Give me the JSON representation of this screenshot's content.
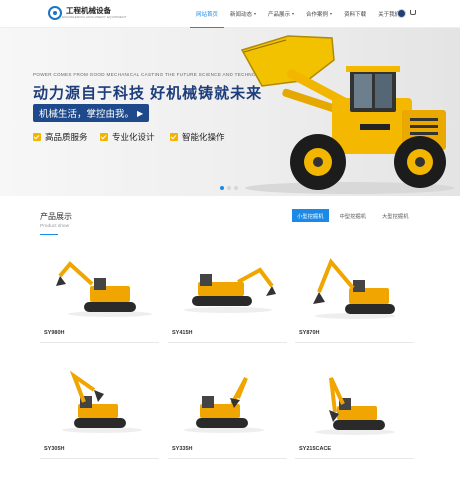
{
  "brand": {
    "name": "工程机械设备",
    "tagline": "ENGINEERING MACHINERY EQUIPMENT"
  },
  "nav": {
    "items": [
      {
        "label": "网站首页",
        "active": true,
        "dropdown": false
      },
      {
        "label": "新闻动态",
        "active": false,
        "dropdown": true
      },
      {
        "label": "产品展示",
        "active": false,
        "dropdown": true
      },
      {
        "label": "合作案例",
        "active": false,
        "dropdown": true
      },
      {
        "label": "资料下载",
        "active": false,
        "dropdown": false
      },
      {
        "label": "关于我们",
        "active": false,
        "dropdown": true
      }
    ],
    "icons": [
      "language-flag-icon",
      "cart-icon"
    ]
  },
  "banner": {
    "english": "POWER COMES FROM GOOD MECHANICAL CASTING THE FUTURE SCIENCE AND TECHNOLOGY",
    "headline": "动力源自于科技  好机械铸就未来",
    "slogan": "机械生活，掌控由我。",
    "features": [
      "高品质服务",
      "专业化设计",
      "智能化操作"
    ],
    "slides": 3,
    "active_slide": 1,
    "accent": "#f3b400",
    "headline_color": "#1d3d7c"
  },
  "products": {
    "title": "产品展示",
    "subtitle": "Product show",
    "tabs": [
      {
        "label": "小型挖掘机",
        "active": true
      },
      {
        "label": "中型挖掘机",
        "active": false
      },
      {
        "label": "大型挖掘机",
        "active": false
      }
    ],
    "items": [
      {
        "name": "SY980H"
      },
      {
        "name": "SY415H"
      },
      {
        "name": "SY870H"
      },
      {
        "name": "SY305H"
      },
      {
        "name": "SY335H"
      },
      {
        "name": "SY215CACE"
      }
    ]
  },
  "colors": {
    "primary": "#1a8ae6",
    "machine": "#f0a500"
  }
}
